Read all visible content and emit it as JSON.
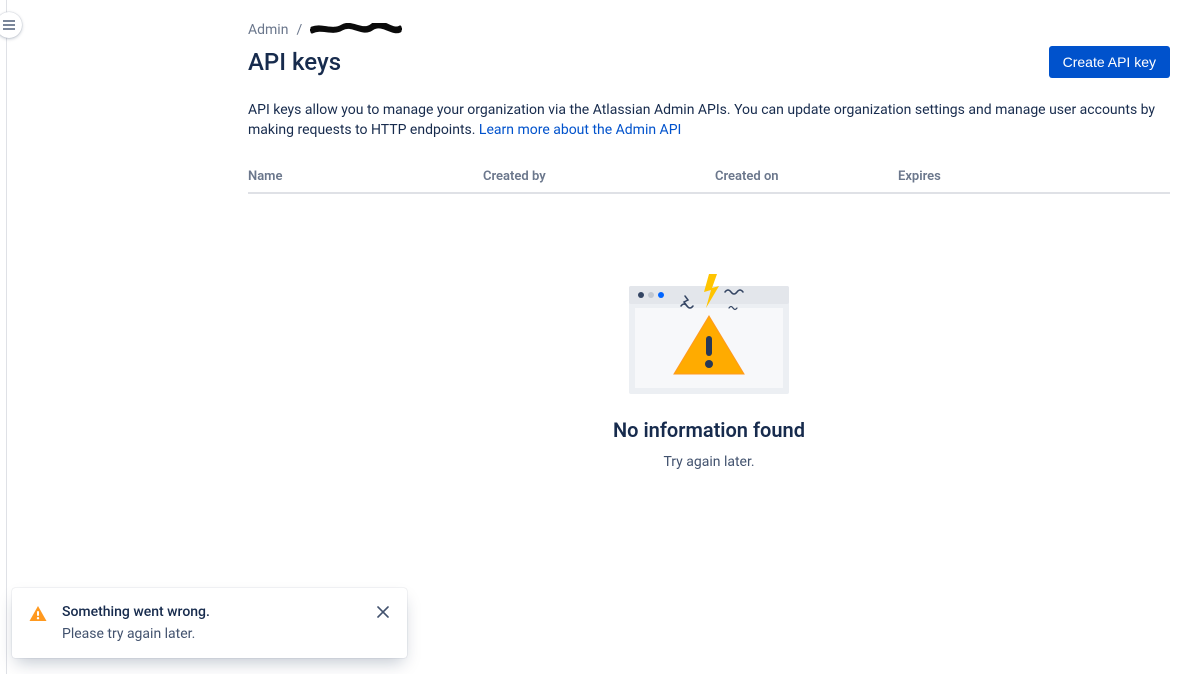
{
  "breadcrumb": {
    "root": "Admin",
    "separator": "/",
    "current_redacted": true
  },
  "header": {
    "title": "API keys",
    "create_button": "Create API key"
  },
  "description": {
    "text": "API keys allow you to manage your organization via the Atlassian Admin APIs. You can update organization settings and manage user accounts by making requests to HTTP endpoints. ",
    "link_text": "Learn more about the Admin API"
  },
  "table": {
    "columns": {
      "name": "Name",
      "created_by": "Created by",
      "created_on": "Created on",
      "expires": "Expires"
    }
  },
  "empty_state": {
    "title": "No information found",
    "subtitle": "Try again later."
  },
  "toast": {
    "title": "Something went wrong.",
    "description": "Please try again later."
  }
}
